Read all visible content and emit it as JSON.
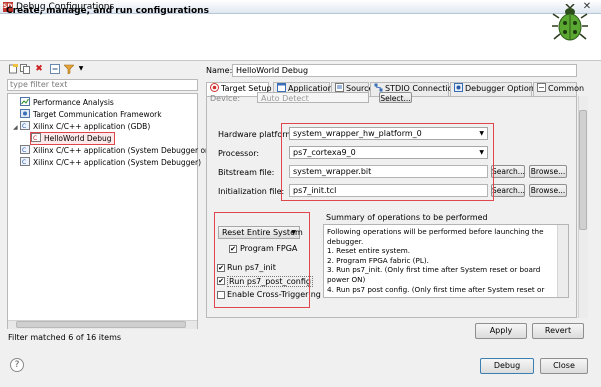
{
  "window": {
    "title": "Debug Configurations",
    "close_glyph": "✕",
    "app_icon_text": "SDK"
  },
  "banner": {
    "title": "Create, manage, and run configurations",
    "icon": "bug-icon"
  },
  "left": {
    "toolbar_icons": [
      "new-launch-config-icon",
      "duplicate-icon",
      "delete-icon",
      "collapse-all-icon",
      "filter-icon",
      "dropdown-icon"
    ],
    "filter_placeholder": "type filter text",
    "tree": [
      {
        "label": "Performance Analysis",
        "icon": "perf-icon",
        "level": 1
      },
      {
        "label": "Target Communication Framework",
        "icon": "tcf-icon",
        "level": 1
      },
      {
        "label": "Xilinx C/C++ application (GDB)",
        "icon": "c-app-icon",
        "level": 1,
        "expanded": true
      },
      {
        "label": "HelloWorld Debug",
        "icon": "c-config-icon",
        "level": 2,
        "selected": true
      },
      {
        "label": "Xilinx C/C++ application (System Debugger on",
        "icon": "c-app-icon",
        "level": 1
      },
      {
        "label": "Xilinx C/C++ application (System Debugger)",
        "icon": "c-app-icon",
        "level": 1
      }
    ],
    "status": "Filter matched 6 of 16 items"
  },
  "config": {
    "name_label": "Name:",
    "name_value": "HelloWorld Debug",
    "tabs": [
      {
        "label": "Target Setup",
        "icon": "target-icon",
        "selected": true
      },
      {
        "label": "Application",
        "icon": "app-icon"
      },
      {
        "label": "Source",
        "icon": "source-icon"
      },
      {
        "label": "STDIO Connection",
        "icon": "connection-icon"
      },
      {
        "label": "Debugger Options",
        "icon": "debugger-icon"
      },
      {
        "label": "Common",
        "icon": "common-icon"
      }
    ],
    "device_label": "Device:",
    "device_value": "Auto Detect",
    "select_btn": "Select...",
    "hw_label": "Hardware platform:",
    "hw_value": "system_wrapper_hw_platform_0",
    "proc_label": "Processor:",
    "proc_value": "ps7_cortexa9_0",
    "bit_label": "Bitstream file:",
    "bit_value": "system_wrapper.bit",
    "init_label": "Initialization file:",
    "init_value": "ps7_init.tcl",
    "search_btn": "Search...",
    "browse_btn": "Browse...",
    "reset_value": "Reset Entire System",
    "program_fpga": {
      "label": "Program FPGA",
      "checked": true
    },
    "run_init": {
      "label": "Run ps7_init",
      "checked": true
    },
    "run_post": {
      "label": "Run ps7_post_config",
      "checked": true
    },
    "cross_trig": {
      "label": "Enable Cross-Triggering",
      "checked": false
    },
    "summary_title": "Summary of operations to be performed",
    "summary_text": "Following operations will be performed before launching the debugger.\n1. Reset entire system.\n2. Program FPGA fabric (PL).\n3. Run ps7_init. (Only first time after System reset or board power ON)\n4. Run ps7 post config. (Only first time after System reset or",
    "apply_btn": "Apply",
    "revert_btn": "Revert"
  },
  "footer": {
    "help_glyph": "?",
    "debug_btn": "Debug",
    "close_btn": "Close"
  },
  "colors": {
    "highlight": "#e0474c",
    "selection": "#fde8ea"
  }
}
